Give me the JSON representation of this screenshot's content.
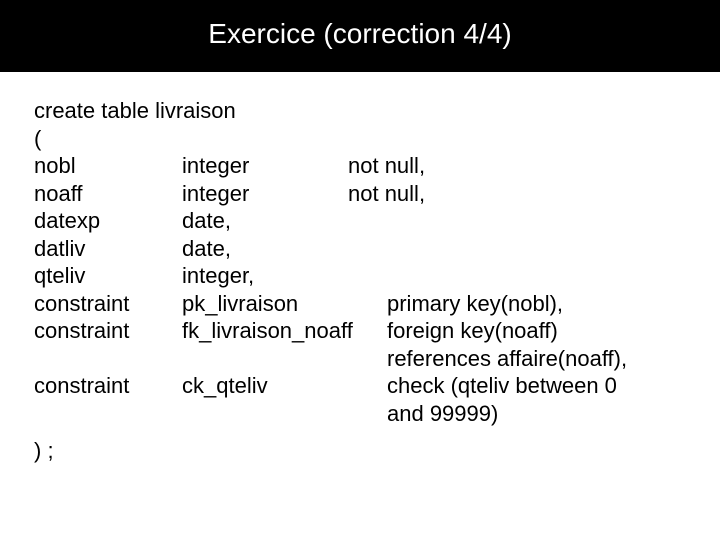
{
  "title": "Exercice (correction 4/4)",
  "lines": {
    "l0": "create table livraison",
    "l1": "(",
    "r2": {
      "c1": "nobl",
      "c2": "integer",
      "c3": "not null,"
    },
    "r3": {
      "c1": "noaff",
      "c2": "integer",
      "c3": "not null,"
    },
    "r4": {
      "c1": "datexp",
      "c2": "date,"
    },
    "r5": {
      "c1": "datliv",
      "c2": "date,"
    },
    "r6": {
      "c1": "qteliv",
      "c2": "integer,"
    },
    "r7": {
      "c1": "constraint",
      "c2": "pk_livraison",
      "c3": "primary key(nobl),"
    },
    "r8": {
      "c1": "constraint",
      "c2": "fk_livraison_noaff",
      "c3": "foreign key(noaff)"
    },
    "r9": {
      "c3": "references affaire(noaff),"
    },
    "r10": {
      "c1": "constraint",
      "c2": "ck_qteliv",
      "c3": "check (qteliv between 0"
    },
    "r11": {
      "c3": "and 99999)"
    },
    "l12": ") ;"
  }
}
